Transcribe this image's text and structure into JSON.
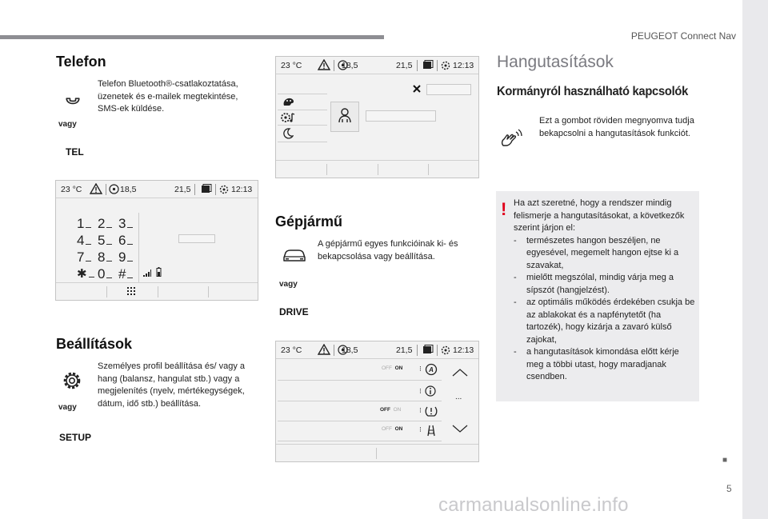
{
  "header": {
    "title": "PEUGEOT Connect Nav"
  },
  "footer": {
    "page_number": "5",
    "dot": "■",
    "watermark": "carmanualsonline.info"
  },
  "status_bar": {
    "temp": "23 °C",
    "left_value": "18,5",
    "right_value": "21,5",
    "time": "12:13"
  },
  "telefon": {
    "title": "Telefon",
    "text": "Telefon Bluetooth®-csatlakoztatása, üzenetek és e-mailek megtekintése, SMS-ek küldése.",
    "or": "vagy",
    "key": "TEL",
    "keypad": [
      "1",
      "2",
      "3",
      "4",
      "5",
      "6",
      "7",
      "8",
      "9",
      "✱",
      "0",
      "#"
    ]
  },
  "beallitasok": {
    "title": "Beállítások",
    "text": "Személyes profil beállítása és/ vagy a hang (balansz, hangulat stb.) vagy a megjelenítés (nyelv, mértékegységek, dátum, idő stb.) beállítása.",
    "or": "vagy",
    "key": "SETUP"
  },
  "gepjarmu": {
    "title": "Gépjármű",
    "text": "A gépjármű egyes funkcióinak ki- és bekapcsolása vagy beállítása.",
    "or": "vagy",
    "key": "DRIVE",
    "toggles": [
      {
        "off": "OFF",
        "on": "ON"
      },
      {
        "off": "OFF",
        "on": "ON"
      },
      {
        "off": "OFF",
        "on": "ON"
      }
    ],
    "more": "..."
  },
  "hangutasitasok": {
    "title": "Hangutasítások",
    "subtitle": "Kormányról használható kapcsolók",
    "text": "Ezt a gombot röviden megnyomva tudja bekapcsolni a hangutasítások funkciót.",
    "warning_intro": "Ha azt szeretné, hogy a rendszer mindig felismerje a hangutasításokat, a következők szerint járjon el:",
    "warning_items": [
      "természetes hangon beszéljen, ne egyesével, megemelt hangon ejtse ki a szavakat,",
      "mielőtt megszólal, mindig várja meg a sípszót (hangjelzést).",
      "az optimális működés érdekében csukja be az ablakokat és a napfénytetőt (ha tartozék), hogy kizárja a zavaró külső zajokat,",
      "a hangutasítások kimondása előtt kérje meg a többi utast, hogy maradjanak csendben."
    ]
  }
}
